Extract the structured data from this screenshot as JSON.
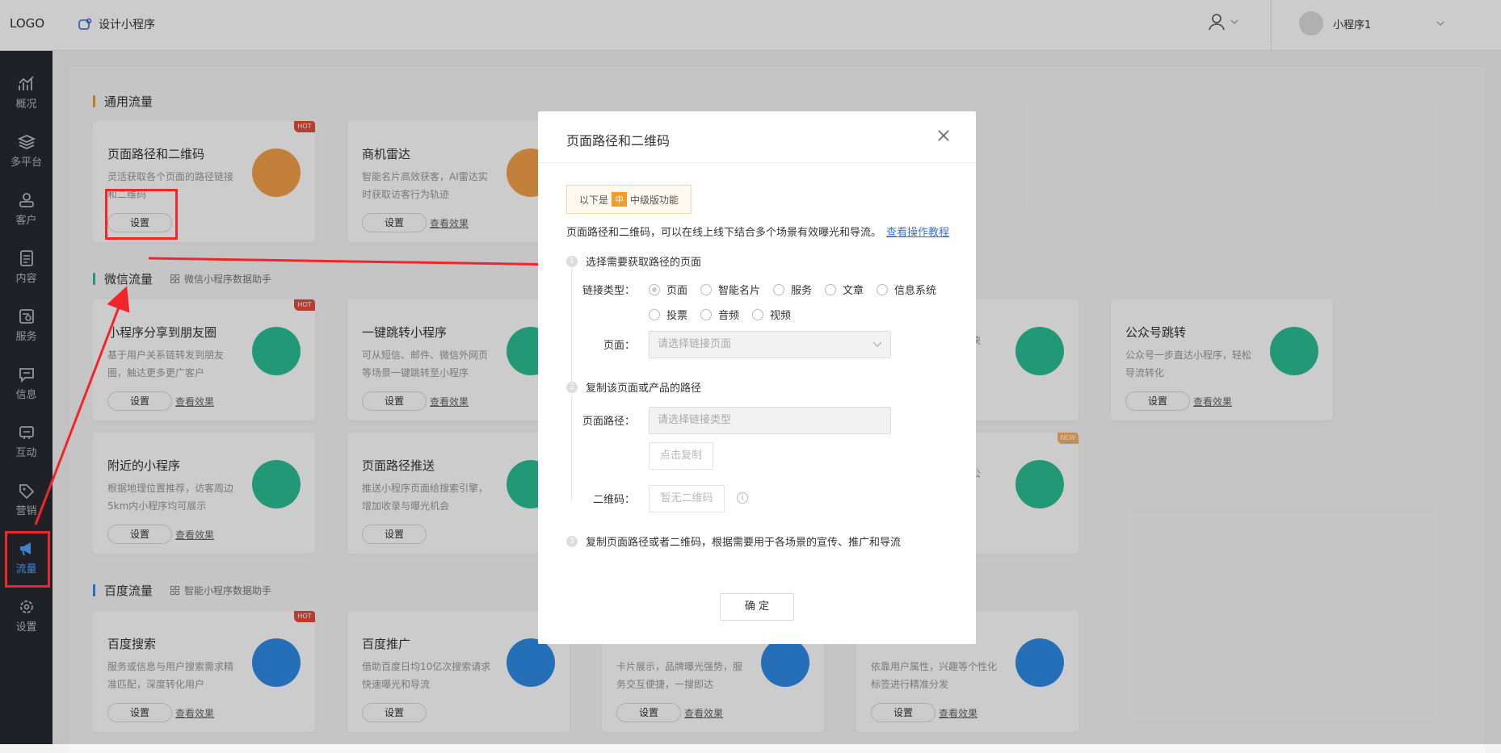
{
  "header": {
    "logo": "LOGO",
    "design": "设计小程序",
    "account": "小程序1"
  },
  "sidebar": [
    {
      "label": "概况",
      "icon": "chart-icon"
    },
    {
      "label": "多平台",
      "icon": "layers-icon"
    },
    {
      "label": "客户",
      "icon": "user-icon"
    },
    {
      "label": "内容",
      "icon": "document-icon"
    },
    {
      "label": "服务",
      "icon": "service-icon"
    },
    {
      "label": "信息",
      "icon": "message-icon"
    },
    {
      "label": "互动",
      "icon": "interact-icon"
    },
    {
      "label": "营销",
      "icon": "tag-icon"
    },
    {
      "label": "流量",
      "icon": "megaphone-icon"
    },
    {
      "label": "设置",
      "icon": "gear-icon"
    }
  ],
  "sections": {
    "general": "通用流量",
    "wechat": "微信流量",
    "wechat_sub": "微信小程序数据助手",
    "baidu": "百度流量",
    "baidu_sub": "智能小程序数据助手"
  },
  "cards": {
    "page_qr": {
      "title": "页面路径和二维码",
      "desc": "灵活获取各个页面的路径链接和二维码",
      "btn": "设置",
      "badge": "HOT"
    },
    "radar": {
      "title": "商机雷达",
      "desc": "智能名片高效获客，AI雷达实时获取访客行为轨迹",
      "btn": "设置",
      "link": "查看效果"
    },
    "share": {
      "title": "小程序分享到朋友圈",
      "desc": "基于用户关系链转发到朋友圈，触达更多更广客户",
      "btn": "设置",
      "link": "查看效果",
      "badge": "HOT"
    },
    "jump": {
      "title": "一键跳转小程序",
      "desc": "可从短信、邮件、微信外网页等场景一键跳转至小程序",
      "btn": "设置",
      "link": "查看效果"
    },
    "mp": {
      "title": "公众号跳转",
      "desc": "公众号一步直达小程序，轻松导流转化",
      "btn": "设置",
      "link": "查看效果"
    },
    "mp_partial": "本快",
    "nearby": {
      "title": "附近的小程序",
      "desc": "根据地理位置推荐，访客周边5km内小程序均可展示",
      "btn": "设置",
      "link": "查看效果"
    },
    "push": {
      "title": "页面路径推送",
      "desc": "推送小程序页面给搜索引擎，增加收录与曝光机会",
      "btn": "设置"
    },
    "video_partial": "从公",
    "video_badge": "NEW",
    "bsearch": {
      "title": "百度搜索",
      "desc": "服务或信息与用户搜索需求精准匹配，深度转化用户",
      "btn": "设置",
      "link": "查看效果",
      "badge": "HOT"
    },
    "bpromo": {
      "title": "百度推广",
      "desc": "借助百度日均10亿次搜索请求快速曝光和导流",
      "btn": "设置"
    },
    "bcard": {
      "desc": "卡片展示，品牌曝光强势，服务交互便捷，一搜即达",
      "btn": "设置",
      "link": "查看效果"
    },
    "bdist": {
      "desc": "依靠用户属性，兴趣等个性化标签进行精准分发",
      "btn": "设置",
      "link": "查看效果"
    }
  },
  "modal": {
    "title": "页面路径和二维码",
    "tag_prefix": "以下是",
    "tag_mid": "中",
    "tag_suffix": "中级版功能",
    "intro": "页面路径和二维码，可以在线上线下结合多个场景有效曝光和导流。",
    "intro_link": "查看操作教程",
    "step1": "选择需要获取路径的页面",
    "step2": "复制该页面或产品的路径",
    "step3": "复制页面路径或者二维码，根据需要用于各场景的宣传、推广和导流",
    "link_type_label": "链接类型：",
    "link_types": [
      "页面",
      "智能名片",
      "服务",
      "文章",
      "信息系统",
      "投票",
      "音频",
      "视频"
    ],
    "page_label": "页面：",
    "page_placeholder": "请选择链接页面",
    "path_label": "页面路径：",
    "path_placeholder": "请选择链接类型",
    "copy_btn": "点击复制",
    "qr_label": "二维码：",
    "qr_btn": "暂无二维码",
    "info_mark": "i",
    "confirm": "确 定"
  },
  "colors": {
    "accent_orange": "#f39c28",
    "accent_green": "#2bbf94",
    "accent_blue": "#2f8be8",
    "arrow_red": "#f0262b"
  }
}
